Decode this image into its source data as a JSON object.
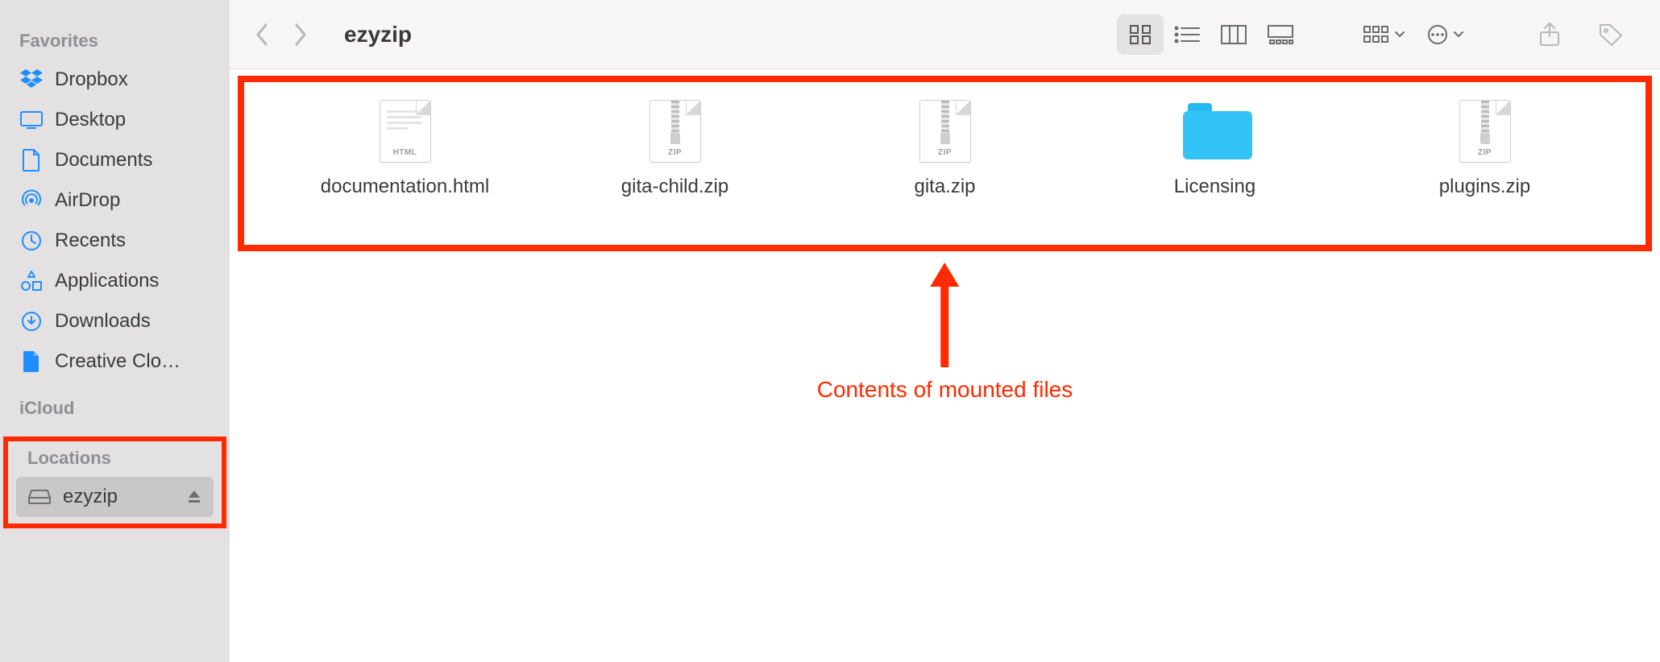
{
  "sidebar": {
    "favorites_label": "Favorites",
    "icloud_label": "iCloud",
    "locations_label": "Locations",
    "favorites": [
      {
        "label": "Dropbox",
        "icon": "dropbox"
      },
      {
        "label": "Desktop",
        "icon": "desktop"
      },
      {
        "label": "Documents",
        "icon": "document"
      },
      {
        "label": "AirDrop",
        "icon": "airdrop"
      },
      {
        "label": "Recents",
        "icon": "clock"
      },
      {
        "label": "Applications",
        "icon": "apps"
      },
      {
        "label": "Downloads",
        "icon": "download"
      },
      {
        "label": "Creative Clo…",
        "icon": "cc-file"
      }
    ],
    "locations": [
      {
        "label": "ezyzip",
        "icon": "drive",
        "selected": true,
        "ejectable": true
      }
    ]
  },
  "toolbar": {
    "title": "ezyzip"
  },
  "files": [
    {
      "label": "documentation.html",
      "kind": "html",
      "tag": "HTML"
    },
    {
      "label": "gita-child.zip",
      "kind": "zip",
      "tag": "ZIP"
    },
    {
      "label": "gita.zip",
      "kind": "zip",
      "tag": "ZIP"
    },
    {
      "label": "Licensing",
      "kind": "folder"
    },
    {
      "label": "plugins.zip",
      "kind": "zip",
      "tag": "ZIP"
    }
  ],
  "annotation": {
    "text": "Contents of mounted files"
  }
}
